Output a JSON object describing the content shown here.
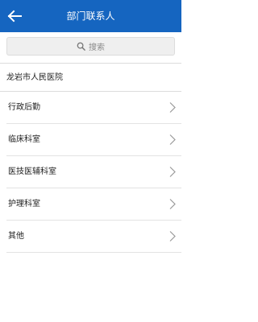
{
  "header": {
    "title": "部门联系人",
    "background_color": "#1565c0",
    "back_icon": "arrow-left-icon"
  },
  "search": {
    "placeholder": "搜索",
    "icon": "search-icon"
  },
  "organization": {
    "name": "龙岩市人民医院"
  },
  "departments": [
    {
      "label": "行政后勤"
    },
    {
      "label": "临床科室"
    },
    {
      "label": "医技医辅科室"
    },
    {
      "label": "护理科室"
    },
    {
      "label": "其他"
    }
  ],
  "chevron_icon": "chevron-right-icon"
}
